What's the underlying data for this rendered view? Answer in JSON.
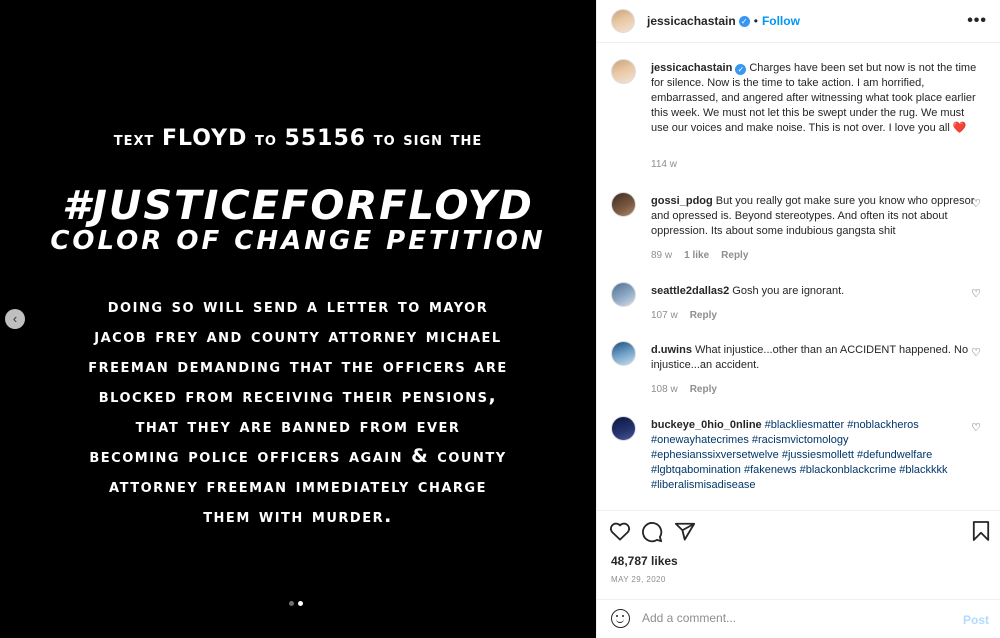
{
  "media": {
    "line1_prefix": "text",
    "line1_floyd": "FLOYD",
    "line1_mid": "to",
    "line1_number": "55156",
    "line1_suffix": "to sign the",
    "hashtag": "#JUSTICEFORFLOYD",
    "petition": "COLOR OF CHANGE PETITION",
    "body_lines": [
      "doing so will send a letter to mayor",
      "jacob frey and county attorney michael",
      "freeman demanding that the officers are",
      "blocked from receiving their pensions,",
      "that they are banned from ever",
      "becoming police officers again & county",
      "attorney freeman immediately charge",
      "them with murder."
    ],
    "prev_icon": "chevron-left-icon",
    "prev_glyph": "‹",
    "carousel_total": 2,
    "carousel_active": 2
  },
  "header": {
    "username": "jessicachastain",
    "verified_glyph": "✓",
    "separator": "•",
    "follow_label": "Follow",
    "more_glyph": "•••"
  },
  "caption": {
    "username": "jessicachastain",
    "text": "Charges have been set but now is not the time for silence. Now is the time to take action. I am horrified, embarrassed, and angered after witnessing what took place earlier this week. We must not let this be swept under the rug. We must use our voices and make noise. This is not over. I love you all",
    "emoji": "❤️",
    "time": "114 w"
  },
  "comments": [
    {
      "username": "gossi_pdog",
      "text": "But you really got make sure you know who oppresor and opressed is. Beyond stereotypes. And often its not about oppression. Its about some indubious gangsta shit",
      "time": "89 w",
      "likes": "1 like",
      "reply": "Reply"
    },
    {
      "username": "seattle2dallas2",
      "text": "Gosh you are ignorant.",
      "time": "107 w",
      "reply": "Reply"
    },
    {
      "username": "d.uwins",
      "text": "What injustice...other than an ACCIDENT happened. No injustice...an accident.",
      "time": "108 w",
      "reply": "Reply"
    },
    {
      "username": "buckeye_0hio_0nline",
      "tags": "#blackliesmatter #noblackheros #onewayhatecrimes #racismvictomology #ephesianssixversetwelve #jussiesmollett #defundwelfare #lgbtqabomination #fakenews #blackonblackcrime #blackkkk #liberalismisadisease"
    }
  ],
  "heart_glyph": "♡",
  "actions": {
    "like_icon": "heart-icon",
    "comment_icon": "comment-icon",
    "share_icon": "share-icon",
    "save_icon": "bookmark-icon"
  },
  "likes": "48,787 likes",
  "date": "MAY 29, 2020",
  "add_comment": {
    "placeholder": "Add a comment...",
    "post_label": "Post"
  },
  "colors": {
    "accent": "#0095f6",
    "verified": "#3897f0",
    "hashtag": "#00376b",
    "post_disabled": "#b3dbff"
  }
}
